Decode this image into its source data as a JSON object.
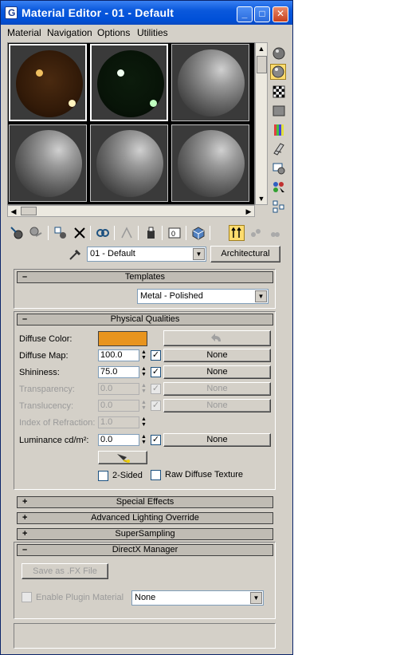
{
  "window": {
    "title": "Material Editor - 01 - Default",
    "controls": {
      "minimize": "_",
      "maximize": "□",
      "close": "✕"
    }
  },
  "menu": [
    "Material",
    "Navigation",
    "Options",
    "Utilities"
  ],
  "material": {
    "name": "01 - Default",
    "type_button": "Architectural"
  },
  "templates": {
    "header": "Templates",
    "sign": "–",
    "value": "Metal - Polished"
  },
  "physical": {
    "header": "Physical Qualities",
    "sign": "–",
    "diffuse_color_label": "Diffuse Color:",
    "diffuse_color": "#e8941e",
    "diffuse_map_label": "Diffuse Map:",
    "diffuse_map_value": "100.0",
    "diffuse_map_button": "None",
    "shininess_label": "Shininess:",
    "shininess_value": "75.0",
    "shininess_button": "None",
    "transparency_label": "Transparency:",
    "transparency_value": "0.0",
    "transparency_button": "None",
    "translucency_label": "Translucency:",
    "translucency_value": "0.0",
    "translucency_button": "None",
    "ior_label": "Index of Refraction:",
    "ior_value": "1.0",
    "luminance_label": "Luminance cd/m²:",
    "luminance_value": "0.0",
    "luminance_button": "None",
    "two_sided_label": "2-Sided",
    "raw_diffuse_label": "Raw Diffuse Texture"
  },
  "rollouts": [
    {
      "sign": "+",
      "label": "Special Effects"
    },
    {
      "sign": "+",
      "label": "Advanced Lighting Override"
    },
    {
      "sign": "+",
      "label": "SuperSampling"
    },
    {
      "sign": "–",
      "label": "DirectX Manager"
    }
  ],
  "directx": {
    "save_fx_label": "Save as .FX File",
    "enable_plugin_label": "Enable Plugin Material",
    "plugin_value": "None"
  },
  "colors": {
    "title_bar": "#0a58dc",
    "panel_bg": "#d4d0c8",
    "active_tool": "#fddc6e"
  }
}
